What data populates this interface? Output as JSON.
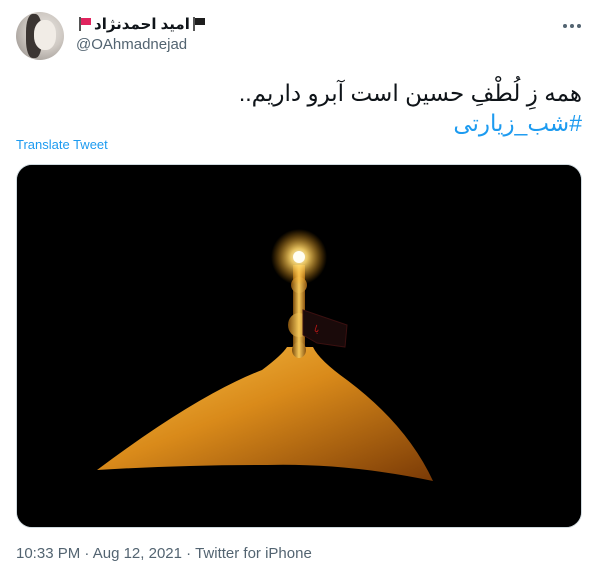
{
  "user": {
    "display_name": "امید احمدنژاد",
    "handle": "@OAhmadnejad"
  },
  "tweet": {
    "text": "همه زِ لُطْفِ حسین است آبرو داریم..",
    "hashtag": "#شب_زیارتی",
    "translate_label": "Translate Tweet"
  },
  "meta": {
    "time": "10:33 PM",
    "separator": "·",
    "date": "Aug 12, 2021",
    "source": "Twitter for iPhone"
  },
  "colors": {
    "link": "#1d9bf0",
    "secondary_text": "#536471",
    "flag_red": "#e0245e"
  },
  "media": {
    "description_icon": "golden-dome-photo"
  }
}
